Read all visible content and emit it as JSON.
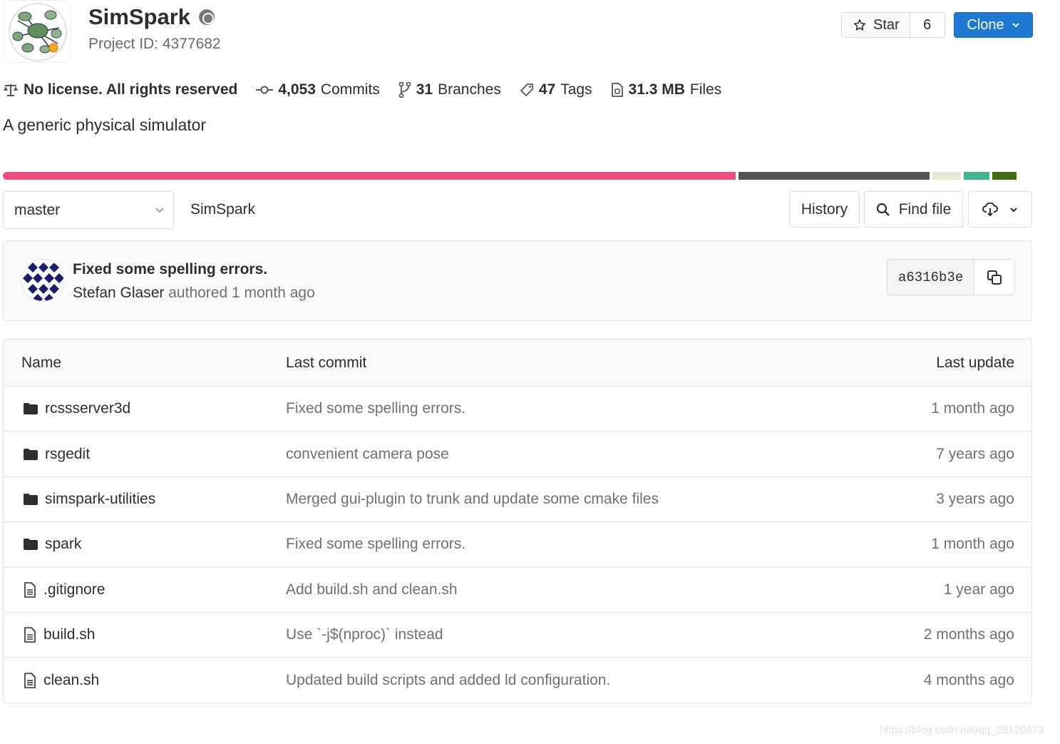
{
  "project": {
    "name": "SimSpark",
    "id_label": "Project ID: 4377682"
  },
  "star": {
    "label": "Star",
    "count": "6"
  },
  "clone": {
    "label": "Clone"
  },
  "stats": {
    "license": "No license. All rights reserved",
    "commits_count": "4,053",
    "commits_label": "Commits",
    "branches_count": "31",
    "branches_label": "Branches",
    "tags_count": "47",
    "tags_label": "Tags",
    "files_size": "31.3 MB",
    "files_label": "Files"
  },
  "description": "A generic physical simulator",
  "language_colors": [
    "#f34b7d",
    "#555555",
    "#e4ead4",
    "#3fb68b",
    "#3f6d0f"
  ],
  "nav": {
    "branch": "master",
    "breadcrumb": "SimSpark",
    "history": "History",
    "find_file": "Find file"
  },
  "last_commit": {
    "message": "Fixed some spelling errors.",
    "author": "Stefan Glaser",
    "action": "authored",
    "time": "1 month ago",
    "sha": "a6316b3e"
  },
  "tree": {
    "headers": {
      "name": "Name",
      "last_commit": "Last commit",
      "last_update": "Last update"
    },
    "rows": [
      {
        "type": "folder",
        "name": "rcssserver3d",
        "commit": "Fixed some spelling errors.",
        "updated": "1 month ago"
      },
      {
        "type": "folder",
        "name": "rsgedit",
        "commit": "convenient camera pose",
        "updated": "7 years ago"
      },
      {
        "type": "folder",
        "name": "simspark-utilities",
        "commit": "Merged gui-plugin to trunk and update some cmake files",
        "updated": "3 years ago"
      },
      {
        "type": "folder",
        "name": "spark",
        "commit": "Fixed some spelling errors.",
        "updated": "1 month ago"
      },
      {
        "type": "file",
        "name": ".gitignore",
        "commit": "Add build.sh and clean.sh",
        "updated": "1 year ago"
      },
      {
        "type": "file",
        "name": "build.sh",
        "commit": "Use `-j$(nproc)` instead",
        "updated": "2 months ago"
      },
      {
        "type": "file",
        "name": "clean.sh",
        "commit": "Updated build scripts and added ld configuration.",
        "updated": "4 months ago"
      }
    ]
  },
  "watermark": "https://blog.csdn.net/qq_28120673"
}
